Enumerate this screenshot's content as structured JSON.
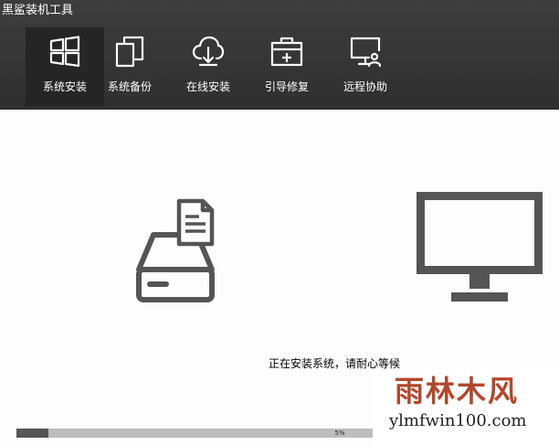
{
  "app": {
    "title": "黑鲨装机工具"
  },
  "nav": {
    "items": [
      {
        "label": "系统安装",
        "icon": "windows-icon",
        "active": true
      },
      {
        "label": "系统备份",
        "icon": "copy-icon",
        "active": false
      },
      {
        "label": "在线安装",
        "icon": "cloud-download-icon",
        "active": false
      },
      {
        "label": "引导修复",
        "icon": "toolbox-icon",
        "active": false
      },
      {
        "label": "远程协助",
        "icon": "remote-monitor-icon",
        "active": false
      }
    ]
  },
  "main": {
    "illustrations": {
      "left": "hard-drive-file-icon",
      "right": "monitor-icon"
    },
    "status_text": "正在安装系统，请耐心等候"
  },
  "progress": {
    "value": 0.05,
    "label": "5%"
  },
  "watermark": {
    "cn": "雨林木风",
    "en": "ylmfwin100.com"
  },
  "colors": {
    "header_bg": "#333333",
    "active_nav_bg": "#262626",
    "progress_fill": "#555555",
    "progress_track": "#bdbdbd",
    "illustration": "#555555"
  }
}
